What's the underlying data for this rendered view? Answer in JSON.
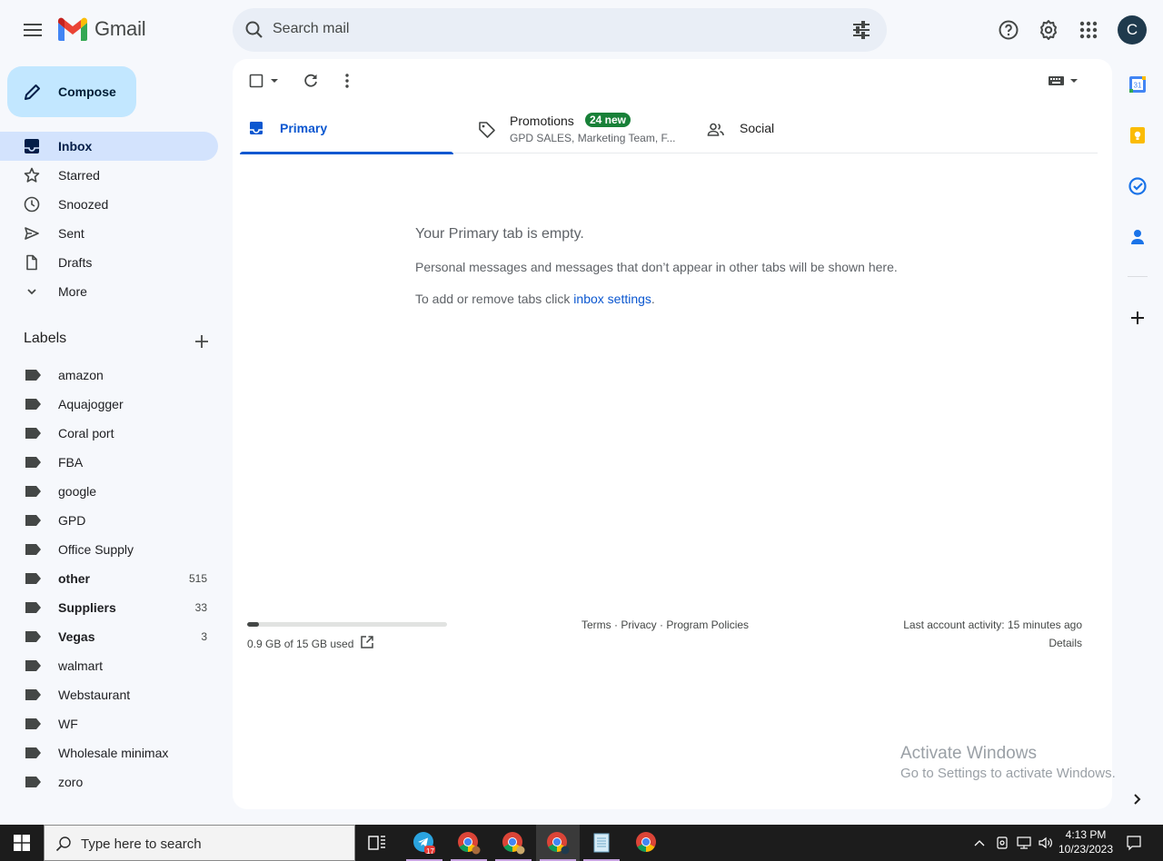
{
  "app": {
    "name": "Gmail",
    "brand_color": "#ea4335",
    "accent": "#0b57d0"
  },
  "search": {
    "placeholder": "Search mail"
  },
  "avatar": {
    "initial": "C",
    "color": "#1f3a4d"
  },
  "compose": {
    "label": "Compose"
  },
  "nav": [
    {
      "label": "Inbox",
      "icon": "inbox-icon",
      "active": true
    },
    {
      "label": "Starred",
      "icon": "star-icon"
    },
    {
      "label": "Snoozed",
      "icon": "clock-icon"
    },
    {
      "label": "Sent",
      "icon": "send-icon"
    },
    {
      "label": "Drafts",
      "icon": "draft-icon"
    },
    {
      "label": "More",
      "icon": "chevron-down-icon"
    }
  ],
  "labels": {
    "heading": "Labels",
    "items": [
      {
        "name": "amazon",
        "count": ""
      },
      {
        "name": "Aquajogger",
        "count": ""
      },
      {
        "name": "Coral port",
        "count": ""
      },
      {
        "name": "FBA",
        "count": ""
      },
      {
        "name": "google",
        "count": ""
      },
      {
        "name": "GPD",
        "count": ""
      },
      {
        "name": "Office Supply",
        "count": ""
      },
      {
        "name": "other",
        "count": "515",
        "bold": true
      },
      {
        "name": "Suppliers",
        "count": "33",
        "bold": true
      },
      {
        "name": "Vegas",
        "count": "3",
        "bold": true
      },
      {
        "name": "walmart",
        "count": ""
      },
      {
        "name": "Webstaurant",
        "count": ""
      },
      {
        "name": "WF",
        "count": ""
      },
      {
        "name": "Wholesale minimax",
        "count": ""
      },
      {
        "name": "zoro",
        "count": ""
      }
    ]
  },
  "tabs": {
    "primary": {
      "label": "Primary"
    },
    "promotions": {
      "label": "Promotions",
      "badge": "24 new",
      "snippet": "GPD SALES, Marketing Team, F..."
    },
    "social": {
      "label": "Social"
    }
  },
  "empty": {
    "title": "Your Primary tab is empty.",
    "body": "Personal messages and messages that don’t appear in other tabs will be shown here.",
    "tabs_prefix": "To add or remove tabs click ",
    "tabs_link": "inbox settings",
    "tabs_suffix": "."
  },
  "footer": {
    "storage_text": "0.9 GB of 15 GB used",
    "storage_fraction": 0.06,
    "links": "Terms · Privacy · Program Policies",
    "activity": "Last account activity: 15 minutes ago",
    "details": "Details"
  },
  "watermark": {
    "line1": "Activate Windows",
    "line2": "Go to Settings to activate Windows."
  },
  "taskbar": {
    "search_placeholder": "Type here to search",
    "telegram_badge": "17",
    "time": "4:13 PM",
    "date": "10/23/2023"
  }
}
